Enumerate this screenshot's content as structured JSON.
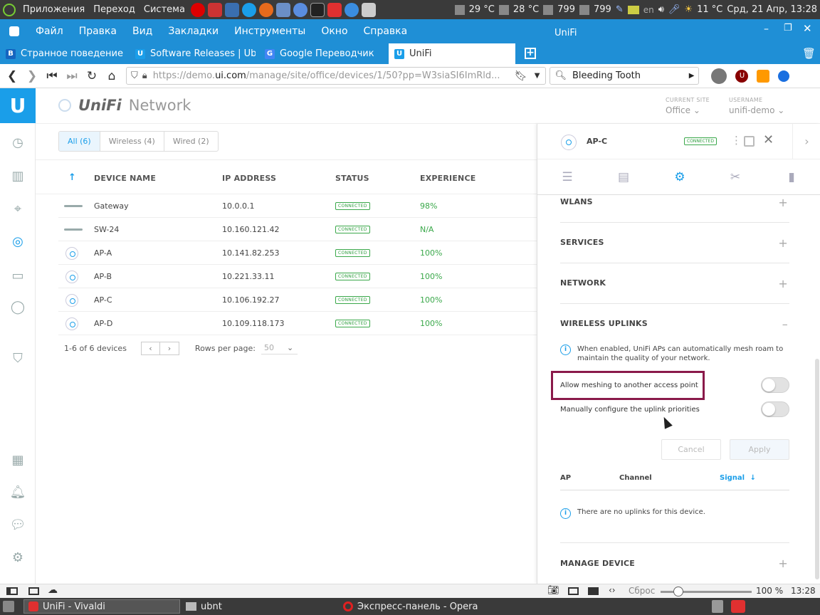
{
  "system_panel": {
    "menus": [
      "Приложения",
      "Переход",
      "Система"
    ],
    "temp1": "29 °C",
    "temp2": "28 °C",
    "mem1": "799",
    "mem2": "799",
    "lang": "en",
    "weather": "11 °C",
    "clock": "Срд, 21 Апр, 13:28"
  },
  "browser": {
    "menus": [
      "Файл",
      "Правка",
      "Вид",
      "Закладки",
      "Инструменты",
      "Окно",
      "Справка"
    ],
    "window_title": "UniFi",
    "tabs": [
      {
        "label": "Странное поведение т",
        "color": "#1565c0"
      },
      {
        "label": "Software Releases | Ubi",
        "color": "#1a9ee9"
      },
      {
        "label": "Google Переводчик",
        "color": "#4285f4"
      },
      {
        "label": "UniFi",
        "color": "#1a9ee9"
      }
    ],
    "url_prefix": "https://demo.",
    "url_host": "ui.com",
    "url_rest": "/manage/site/office/devices/1/50?pp=W3siaSI6ImRld...",
    "search_value": "Bleeding Tooth"
  },
  "app": {
    "brand_a": "UniFi",
    "brand_b": "Network",
    "current_site_label": "CURRENT SITE",
    "current_site": "Office",
    "username_label": "USERNAME",
    "username": "unifi-demo"
  },
  "filters": [
    "All (6)",
    "Wireless (4)",
    "Wired (2)"
  ],
  "table": {
    "headers": {
      "name": "DEVICE NAME",
      "ip": "IP ADDRESS",
      "status": "STATUS",
      "experience": "EXPERIENCE"
    },
    "rows": [
      {
        "name": "Gateway",
        "ip": "10.0.0.1",
        "status": "CONNECTED",
        "experience": "98%",
        "kind": "wired"
      },
      {
        "name": "SW-24",
        "ip": "10.160.121.42",
        "status": "CONNECTED",
        "experience": "N/A",
        "kind": "wired"
      },
      {
        "name": "AP-A",
        "ip": "10.141.82.253",
        "status": "CONNECTED",
        "experience": "100%",
        "kind": "ap"
      },
      {
        "name": "AP-B",
        "ip": "10.221.33.11",
        "status": "CONNECTED",
        "experience": "100%",
        "kind": "ap"
      },
      {
        "name": "AP-C",
        "ip": "10.106.192.27",
        "status": "CONNECTED",
        "experience": "100%",
        "kind": "ap"
      },
      {
        "name": "AP-D",
        "ip": "10.109.118.173",
        "status": "CONNECTED",
        "experience": "100%",
        "kind": "ap"
      }
    ],
    "pager_text": "1-6 of 6 devices",
    "rows_per_page_label": "Rows per page:",
    "rows_per_page": "50"
  },
  "panel": {
    "device": "AP-C",
    "status": "CONNECTED",
    "sections": {
      "wlans": "WLANS",
      "services": "SERVICES",
      "network": "NETWORK",
      "wireless_uplinks": "WIRELESS UPLINKS",
      "manage_device": "MANAGE DEVICE"
    },
    "uplink_info": "When enabled, UniFi APs can automatically mesh roam to maintain the quality of your network.",
    "allow_meshing": "Allow meshing to another access point",
    "manual_uplink": "Manually configure the uplink priorities",
    "cancel": "Cancel",
    "apply": "Apply",
    "col_ap": "AP",
    "col_channel": "Channel",
    "col_signal": "Signal",
    "no_uplinks": "There are no uplinks for this device."
  },
  "statusbar": {
    "reset": "Сброс",
    "zoom": "100 %",
    "time": "13:28"
  },
  "taskbar": [
    {
      "label": "UniFi - Vivaldi",
      "active": true
    },
    {
      "label": "ubnt",
      "active": false
    },
    {
      "label": "Экспресс-панель - Opera",
      "active": false
    }
  ]
}
